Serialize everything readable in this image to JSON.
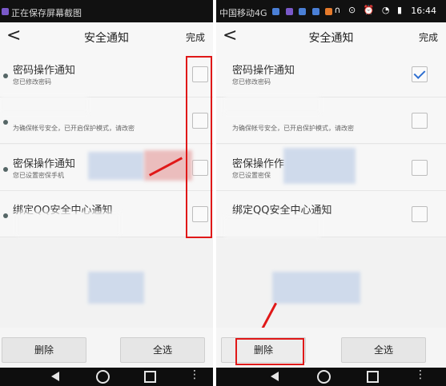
{
  "left": {
    "statusbar": {
      "text": "正在保存屏幕截图"
    },
    "header": {
      "back_glyph": "<",
      "title": "安全通知",
      "done_label": "完成"
    },
    "items": [
      {
        "title": "密码操作通知",
        "subtitle": "您已修改密码",
        "checked": false
      },
      {
        "title": "",
        "subtitle": "为确保帐号安全，已开启保护模式，请改密",
        "checked": false
      },
      {
        "title": "密保操作通知",
        "subtitle": "您已设置密保手机",
        "checked": false
      },
      {
        "title": "绑定QQ安全中心通知",
        "subtitle": "",
        "checked": false
      }
    ],
    "footer": {
      "delete_label": "删除",
      "select_all_label": "全选"
    }
  },
  "right": {
    "statusbar": {
      "carrier": "中国移动4G",
      "time": "16:44"
    },
    "header": {
      "back_glyph": "<",
      "title": "安全通知",
      "done_label": "完成"
    },
    "items": [
      {
        "title": "密码操作通知",
        "subtitle": "您已修改密码",
        "checked": true
      },
      {
        "title": "",
        "subtitle": "为确保帐号安全，已开启保护模式，请改密",
        "checked": false
      },
      {
        "title": "密保操作作",
        "subtitle": "您已设置密保",
        "checked": false
      },
      {
        "title": "绑定QQ安全中心通知",
        "subtitle": "",
        "checked": false
      }
    ],
    "footer": {
      "delete_label": "删除",
      "select_all_label": "全选"
    }
  },
  "colors": {
    "highlight_red": "#e01818",
    "check_blue": "#2f6fd0"
  }
}
